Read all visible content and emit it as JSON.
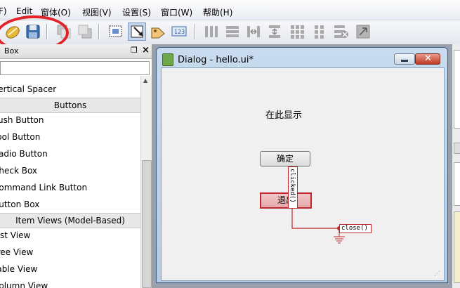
{
  "menubar": {
    "items": [
      "F)",
      "Edit",
      "窗体(O)",
      "视图(V)",
      "设置(S)",
      "窗口(W)",
      "帮助(H)"
    ]
  },
  "toolbar": {
    "buttons": [
      "open-icon",
      "save-icon",
      "send-back-icon",
      "bring-front-icon",
      "edit-widgets-icon",
      "edit-signals-slots-icon",
      "edit-buddies-icon",
      "edit-tab-order-icon",
      "layout-horizontal-icon",
      "layout-vertical-icon",
      "layout-h-splitter-icon",
      "layout-v-splitter-icon",
      "layout-grid-icon",
      "layout-form-icon",
      "break-layout-icon",
      "adjust-size-icon"
    ]
  },
  "widget_box": {
    "title": "Box",
    "items": [
      {
        "label": "Vertical Spacer",
        "kind": "item"
      },
      {
        "label": "Buttons",
        "kind": "category"
      },
      {
        "label": "Push Button",
        "kind": "item"
      },
      {
        "label": "Tool Button",
        "kind": "item"
      },
      {
        "label": "Radio Button",
        "kind": "item"
      },
      {
        "label": "Check Box",
        "kind": "item"
      },
      {
        "label": "Command Link Button",
        "kind": "item"
      },
      {
        "label": "Button Box",
        "kind": "item"
      },
      {
        "label": "Item Views (Model-Based)",
        "kind": "category"
      },
      {
        "label": "List View",
        "kind": "item"
      },
      {
        "label": "Tree View",
        "kind": "item"
      },
      {
        "label": "Table View",
        "kind": "item"
      },
      {
        "label": "Column View",
        "kind": "item"
      }
    ]
  },
  "dialog": {
    "title": "Dialog - hello.ui*",
    "label_text": "在此显示",
    "ok_button": "确定",
    "exit_button": "退出",
    "signal": "clicked()",
    "slot": "close()"
  },
  "colors": {
    "annotation_red": "#e3232a",
    "connection_red": "#c0272d"
  }
}
